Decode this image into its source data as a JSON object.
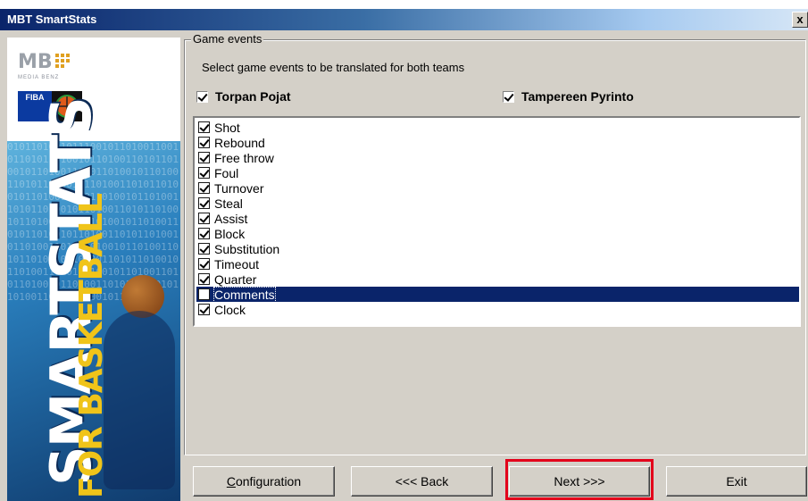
{
  "window": {
    "title": "MBT SmartStats",
    "close_glyph": "x"
  },
  "banner": {
    "brand_logo_text": "MB",
    "brand_sub": "MEDIA BENZ",
    "fiba_label": "FIBA",
    "title_main": "SMARTSTATS",
    "title_sub": "FOR BASKETBALL",
    "binary_text": "0101101001011100101101001100101101011010010110100110101101001011010011010110100101101001101011010010110100110101101001011010011010110100101101001101011010010110100110101101001011010011010110100101101001101011010010110100110101101001011010011010110100101101001101011010010110100110101101001011010011010110100101101001101011010010110100110101101001011010011010110100101101"
  },
  "group": {
    "legend": "Game events",
    "instruction": "Select game events to be translated for both teams"
  },
  "teams": [
    {
      "name": "Torpan Pojat",
      "checked": true
    },
    {
      "name": "Tampereen Pyrinto",
      "checked": true
    }
  ],
  "events": [
    {
      "label": "Shot",
      "checked": true
    },
    {
      "label": "Rebound",
      "checked": true
    },
    {
      "label": "Free throw",
      "checked": true
    },
    {
      "label": "Foul",
      "checked": true
    },
    {
      "label": "Turnover",
      "checked": true
    },
    {
      "label": "Steal",
      "checked": true
    },
    {
      "label": "Assist",
      "checked": true
    },
    {
      "label": "Block",
      "checked": true
    },
    {
      "label": "Substitution",
      "checked": true
    },
    {
      "label": "Timeout",
      "checked": true
    },
    {
      "label": "Quarter",
      "checked": true
    },
    {
      "label": "Comments",
      "checked": false,
      "selected": true
    },
    {
      "label": "Clock",
      "checked": true
    }
  ],
  "buttons": {
    "configuration_prefix": "",
    "configuration_mnemonic": "C",
    "configuration_rest": "onfiguration",
    "back": "<<< Back",
    "next": "Next >>>",
    "exit": "Exit"
  },
  "colors": {
    "selection": "#0a246a",
    "highlight_outline": "#e3001b",
    "window_bg": "#d4d0c8"
  }
}
